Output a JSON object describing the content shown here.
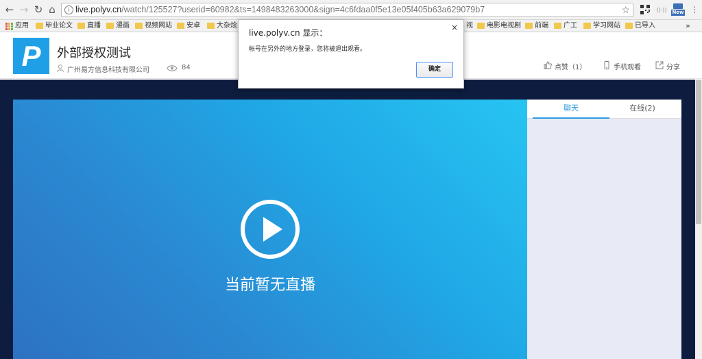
{
  "browser": {
    "url_host": "live.polyv.cn",
    "url_path": "/watch/125527?userid=60982&ts=1498483263000&sign=4c6fdaa0f5e13e05f405b63a629079b7",
    "ext_badge": "New"
  },
  "bookmarks": {
    "apps_label": "应用",
    "items": [
      "毕业论文",
      "直播",
      "漫画",
      "视频网站",
      "安卓",
      "大杂烩"
    ],
    "right_items": [
      "视",
      "电影电视剧",
      "前端",
      "广工",
      "学习网站",
      "已导入"
    ]
  },
  "header": {
    "title": "外部授权测试",
    "company": "广州易方信息科技有限公司",
    "view_count": "84",
    "like_label": "点赞（1）",
    "mobile_label": "手机观看",
    "share_label": "分享",
    "logo_letter": "P"
  },
  "player": {
    "status_text": "当前暂无直播"
  },
  "chat": {
    "tabs": [
      "聊天",
      "在线(2)"
    ],
    "active_tab": 0
  },
  "dialog": {
    "title": "live.polyv.cn 显示：",
    "message": "帐号在另外的地方登录，您将被退出观看。",
    "ok_label": "确定",
    "close_glyph": "×"
  },
  "colors": {
    "accent": "#2f9ae0",
    "logo_bg": "#1fa0e6",
    "stage_bg": "#0e1c3f"
  }
}
